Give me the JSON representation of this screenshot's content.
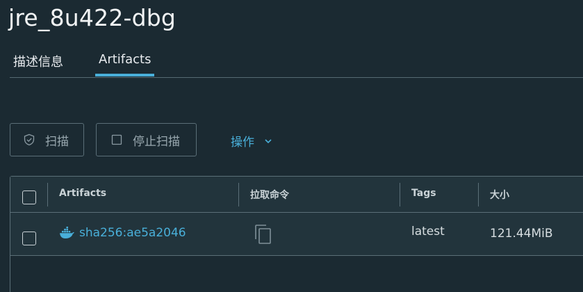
{
  "repository": {
    "title": "jre_8u422-dbg"
  },
  "tabs": [
    {
      "label": "描述信息"
    },
    {
      "label": "Artifacts"
    }
  ],
  "toolbar": {
    "scan_label": "扫描",
    "stop_scan_label": "停止扫描",
    "action_label": "操作"
  },
  "table": {
    "columns": [
      {
        "label": "Artifacts"
      },
      {
        "label": "拉取命令"
      },
      {
        "label": "Tags"
      },
      {
        "label": "大小"
      }
    ],
    "rows": [
      {
        "artifact": "sha256:ae5a2046",
        "artifact_icon": "docker-whale-icon",
        "tags": "latest",
        "size": "121.44MiB"
      }
    ]
  },
  "colors": {
    "background": "#1b2a32",
    "accent": "#49afd9",
    "border": "#5b6f78",
    "row_background": "#22343c"
  }
}
